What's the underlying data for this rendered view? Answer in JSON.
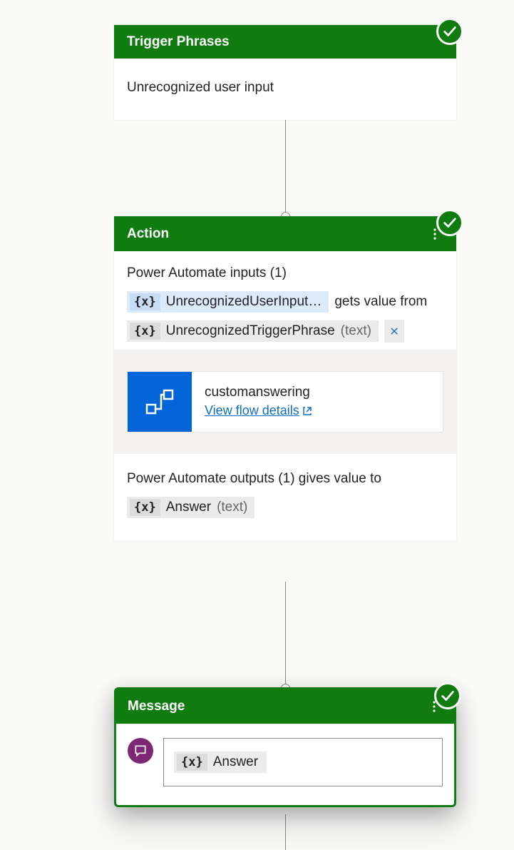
{
  "nodes": {
    "trigger": {
      "title": "Trigger Phrases",
      "content": "Unrecognized user input"
    },
    "action": {
      "title": "Action",
      "inputs_label": "Power Automate inputs (1)",
      "input_var": "UnrecognizedUserInput…",
      "gets_from_label": "gets value from",
      "source_var": "UnrecognizedTriggerPhrase",
      "source_type": "(text)",
      "flow": {
        "name": "customanswering",
        "link_label": "View flow details"
      },
      "outputs_label": "Power Automate outputs (1) gives value to",
      "output_var": "Answer",
      "output_type": "(text)"
    },
    "message": {
      "title": "Message",
      "answer_var": "Answer"
    }
  },
  "glyphs": {
    "var": "{x}"
  }
}
